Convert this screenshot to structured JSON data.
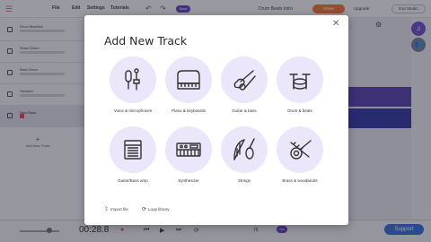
{
  "topbar": {
    "menu": [
      "File",
      "Edit",
      "Settings",
      "Tutorials"
    ],
    "save_label": "Save",
    "song_title": "Drum Beats Intro",
    "share_label": "Share",
    "upgrade_label": "Upgrade",
    "exit_label": "Exit Studio"
  },
  "tracks": [
    {
      "name": "Drum Machine"
    },
    {
      "name": "Snare Drum"
    },
    {
      "name": "Bass Drum"
    },
    {
      "name": "Sampler"
    },
    {
      "name": "New Bass"
    }
  ],
  "add_track_label": "Add New Track",
  "modal": {
    "title": "Add New Track",
    "tiles": [
      {
        "label": "Voice & microphones",
        "icon": "microphone-icon"
      },
      {
        "label": "Piano & keyboards",
        "icon": "piano-icon"
      },
      {
        "label": "Guitar & bass",
        "icon": "guitar-icon"
      },
      {
        "label": "Drum & beats",
        "icon": "drum-icon"
      },
      {
        "label": "Guitar/Bass amp",
        "icon": "amp-icon"
      },
      {
        "label": "Synthesizer",
        "icon": "synthesizer-icon"
      },
      {
        "label": "Strings",
        "icon": "strings-icon"
      },
      {
        "label": "Brass & woodwinds",
        "icon": "brass-icon"
      }
    ],
    "import_label": "Import file",
    "loop_label": "Loop library"
  },
  "transport": {
    "time": "00:28.8",
    "tempo": "75",
    "metronome_toggle": "On",
    "support_label": "Support"
  },
  "colors": {
    "accent": "#5b3ab8",
    "share": "#f26c2b",
    "support": "#2f65d8",
    "tile_bg": "#ece6fb"
  }
}
